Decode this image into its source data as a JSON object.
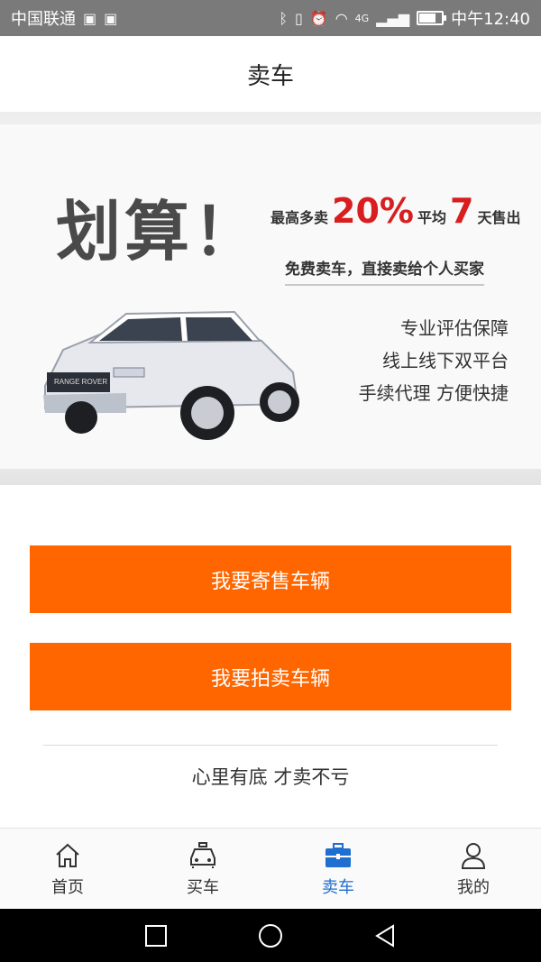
{
  "status_bar": {
    "carrier": "中国联通",
    "network": "4G",
    "time": "中午12:40"
  },
  "header": {
    "title": "卖车"
  },
  "banner": {
    "headline": "划算！",
    "promo_prefix": "最高多卖",
    "promo_percent": "20%",
    "promo_mid": "平均",
    "promo_days": "7",
    "promo_suffix": "天售出",
    "sub_promo": "免费卖车，直接卖给个人买家",
    "features": [
      "专业评估保障",
      "线上线下双平台",
      "手续代理 方便快捷"
    ],
    "car_plate_text": "RANGE ROVER"
  },
  "actions": {
    "consign": "我要寄售车辆",
    "auction": "我要拍卖车辆"
  },
  "tagline": "心里有底 才卖不亏",
  "tabs": [
    {
      "label": "首页",
      "icon": "home-icon",
      "active": false
    },
    {
      "label": "买车",
      "icon": "car-icon",
      "active": false
    },
    {
      "label": "卖车",
      "icon": "briefcase-icon",
      "active": true
    },
    {
      "label": "我的",
      "icon": "user-icon",
      "active": false
    }
  ],
  "colors": {
    "accent": "#ff6600",
    "tab_active": "#1e6fd0",
    "promo_red": "#d81e1e"
  }
}
